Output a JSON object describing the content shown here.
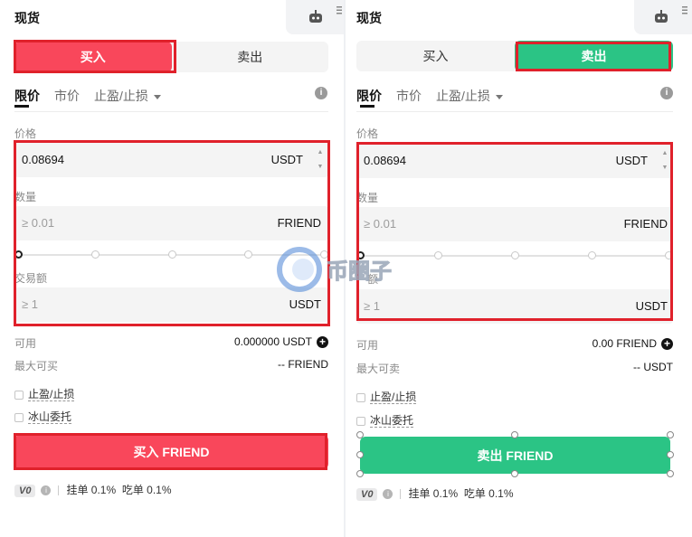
{
  "left": {
    "title": "现货",
    "buy_label": "买入",
    "sell_label": "卖出",
    "order_tabs": [
      "限价",
      "市价",
      "止盈/止损"
    ],
    "price_label": "价格",
    "price_value": "0.08694",
    "price_unit": "USDT",
    "qty_label": "数量",
    "qty_placeholder": "≥ 0.01",
    "qty_unit": "FRIEND",
    "amount_label": "交易额",
    "amount_placeholder": "≥ 1",
    "amount_unit": "USDT",
    "available_label": "可用",
    "available_value": "0.000000 USDT",
    "max_label": "最大可买",
    "max_value": "-- FRIEND",
    "tpsl_label": "止盈/止损",
    "iceberg_label": "冰山委托",
    "action_label": "买入 FRIEND",
    "vip": "V0",
    "maker_fee": "挂单 0.1%",
    "taker_fee": "吃单 0.1%"
  },
  "right": {
    "title": "现货",
    "buy_label": "买入",
    "sell_label": "卖出",
    "order_tabs": [
      "限价",
      "市价",
      "止盈/止损"
    ],
    "price_label": "价格",
    "price_value": "0.08694",
    "price_unit": "USDT",
    "qty_label": "数量",
    "qty_placeholder": "≥ 0.01",
    "qty_unit": "FRIEND",
    "amount_label": "额",
    "amount_placeholder": "≥ 1",
    "amount_unit": "USDT",
    "available_label": "可用",
    "available_value": "0.00 FRIEND",
    "max_label": "最大可卖",
    "max_value": "-- USDT",
    "tpsl_label": "止盈/止损",
    "iceberg_label": "冰山委托",
    "action_label": "卖出 FRIEND",
    "vip": "V0",
    "maker_fee": "挂单 0.1%",
    "taker_fee": "吃单 0.1%"
  },
  "watermark": "币圈子",
  "colors": {
    "buy": "#f9475b",
    "sell": "#2bc485",
    "highlight": "#e0212b"
  }
}
